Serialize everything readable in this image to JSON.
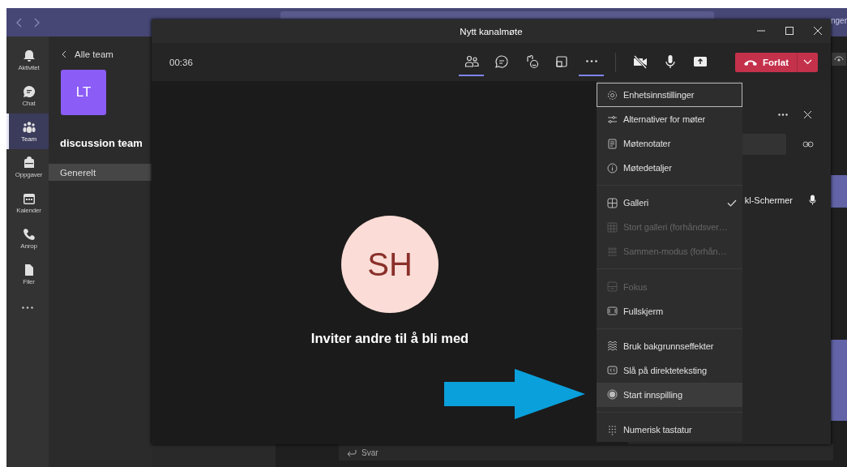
{
  "top_bar": {
    "cut_text": "nger"
  },
  "rail": {
    "items": [
      {
        "label": "Aktivitet",
        "selected": false
      },
      {
        "label": "Chat",
        "selected": false
      },
      {
        "label": "Team",
        "selected": true
      },
      {
        "label": "Oppgaver",
        "selected": false
      },
      {
        "label": "Kalender",
        "selected": false
      },
      {
        "label": "Anrop",
        "selected": false
      },
      {
        "label": "Filer",
        "selected": false
      }
    ]
  },
  "team_panel": {
    "back_link": "Alle team",
    "avatar": "LT",
    "team_name": "discussion team",
    "channels": [
      {
        "name": "Generelt",
        "selected": true
      }
    ]
  },
  "chat": {
    "reply": "Svar"
  },
  "meeting": {
    "title": "Nytt kanalmøte",
    "timer": "00:36",
    "tools": [
      {
        "selected": true
      },
      {
        "selected": false
      },
      {
        "selected": false
      },
      {
        "selected": false
      },
      {
        "selected": true
      }
    ],
    "camera_off": true,
    "leave": "Forlat",
    "avatar": "SH",
    "invite": "Inviter andre til å bli med",
    "participant": "kl-Schermer"
  },
  "menu": {
    "groups": [
      [
        {
          "label": "Enhetsinnstillinger",
          "disabled": false,
          "checked": false,
          "focused": true,
          "highlighted": false
        },
        {
          "label": "Alternativer for møter",
          "disabled": false,
          "checked": false,
          "focused": false,
          "highlighted": false
        },
        {
          "label": "Møtenotater",
          "disabled": false,
          "checked": false,
          "focused": false,
          "highlighted": false
        },
        {
          "label": "Møtedetaljer",
          "disabled": false,
          "checked": false,
          "focused": false,
          "highlighted": false
        }
      ],
      [
        {
          "label": "Galleri",
          "disabled": false,
          "checked": true,
          "focused": false,
          "highlighted": false
        },
        {
          "label": "Stort galleri (forhåndsver…",
          "disabled": true,
          "checked": false,
          "focused": false,
          "highlighted": false
        },
        {
          "label": "Sammen-modus (forhån…",
          "disabled": true,
          "checked": false,
          "focused": false,
          "highlighted": false
        }
      ],
      [
        {
          "label": "Fokus",
          "disabled": true,
          "checked": false,
          "focused": false,
          "highlighted": false
        },
        {
          "label": "Fullskjerm",
          "disabled": false,
          "checked": false,
          "focused": false,
          "highlighted": false
        }
      ],
      [
        {
          "label": "Bruk bakgrunnseffekter",
          "disabled": false,
          "checked": false,
          "focused": false,
          "highlighted": false
        },
        {
          "label": "Slå på direkteteksting",
          "disabled": false,
          "checked": false,
          "focused": false,
          "highlighted": false
        },
        {
          "label": "Start innspilling",
          "disabled": false,
          "checked": false,
          "focused": false,
          "highlighted": true
        }
      ],
      [
        {
          "label": "Numerisk tastatur",
          "disabled": false,
          "checked": false,
          "focused": false,
          "highlighted": false
        }
      ]
    ]
  }
}
